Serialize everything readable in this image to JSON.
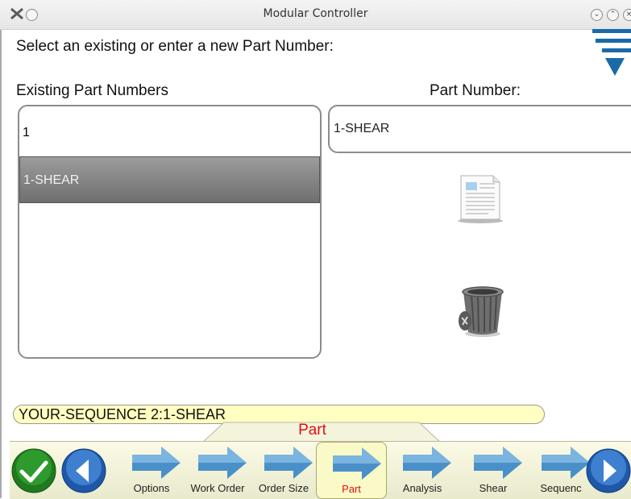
{
  "window": {
    "title": "Modular Controller"
  },
  "prompt": "Select an existing or enter a new Part Number:",
  "existing": {
    "header": "Existing Part Numbers",
    "items": [
      {
        "label": "1",
        "selected": false
      },
      {
        "label": "1-SHEAR",
        "selected": true
      }
    ]
  },
  "part": {
    "header": "Part Number:",
    "value": "1-SHEAR"
  },
  "status": "YOUR-SEQUENCE 2:1-SHEAR",
  "tab_title": "Part",
  "nav": {
    "steps": [
      {
        "label": "Options"
      },
      {
        "label": "Work Order"
      },
      {
        "label": "Order Size"
      },
      {
        "label": "Part",
        "active": true
      },
      {
        "label": "Analysis"
      },
      {
        "label": "Shear"
      },
      {
        "label": "Sequenc"
      }
    ]
  },
  "colors": {
    "accent_active": "#e01010",
    "selection": "#808080",
    "status_bg": "#ffffc2",
    "nav_bg": "#f4f4dc",
    "logo": "#1a6aa8"
  },
  "icons": [
    "app-icon",
    "minimize-icon",
    "maximize-icon",
    "close-icon",
    "logo-icon",
    "new-document-icon",
    "trash-icon",
    "confirm-check-icon",
    "back-arrow-icon",
    "forward-arrow-icon",
    "step-arrow-icon"
  ]
}
